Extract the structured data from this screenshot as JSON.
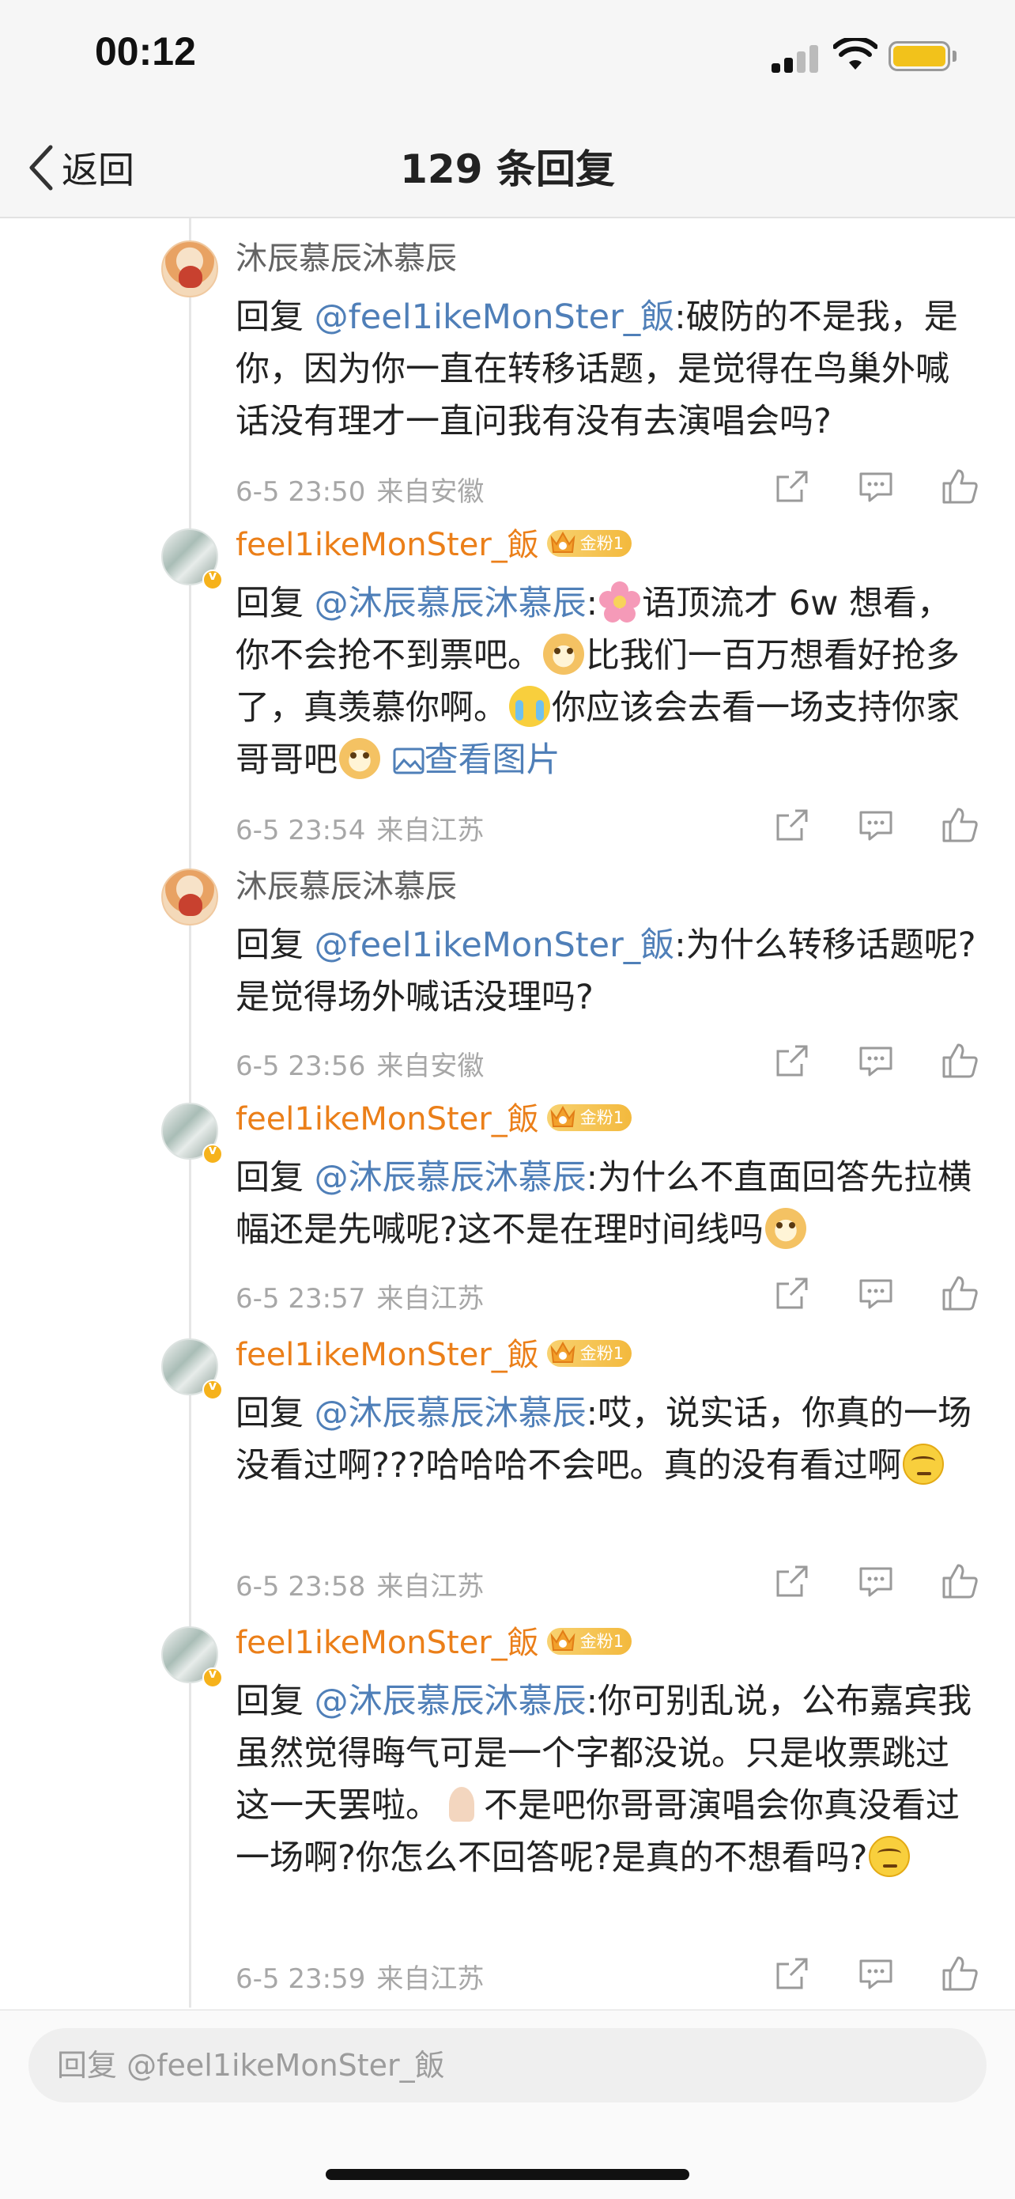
{
  "status_bar": {
    "time": "00:12"
  },
  "nav": {
    "back_label": "返回",
    "title": "129 条回复"
  },
  "replies": [
    {
      "user": "沐辰慕辰沐慕辰",
      "badge": "",
      "prefix": "回复 ",
      "mention": "@feel1ikeMonSter_飯",
      "text_parts": [
        ":破防的不是我，是你，因为你一直在转移话题，是觉得在鸟巢外喊话没有理才一直问我有没有去演唱会吗?"
      ],
      "time": "6-5 23:50",
      "source": "来自安徽"
    },
    {
      "user": "feel1ikeMonSter_飯",
      "badge": "金粉1",
      "prefix": "回复 ",
      "mention": "@沐辰慕辰沐慕辰",
      "text_parts": [
        ":",
        "语顶流才 6w 想看，你不会抢不到票吧。",
        "比我们一百万想看好抢多了，真羡慕你啊。",
        "你应该会去看一场支持你家哥哥吧"
      ],
      "link": "查看图片",
      "time": "6-5 23:54",
      "source": "来自江苏"
    },
    {
      "user": "沐辰慕辰沐慕辰",
      "badge": "",
      "prefix": "回复 ",
      "mention": "@feel1ikeMonSter_飯",
      "text_parts": [
        ":为什么转移话题呢?是觉得场外喊话没理吗?"
      ],
      "time": "6-5 23:56",
      "source": "来自安徽"
    },
    {
      "user": "feel1ikeMonSter_飯",
      "badge": "金粉1",
      "prefix": "回复 ",
      "mention": "@沐辰慕辰沐慕辰",
      "text_parts": [
        ":为什么不直面回答先拉横幅还是先喊呢?这不是在理时间线吗"
      ],
      "time": "6-5 23:57",
      "source": "来自江苏"
    },
    {
      "user": "feel1ikeMonSter_飯",
      "badge": "金粉1",
      "prefix": "回复 ",
      "mention": "@沐辰慕辰沐慕辰",
      "text_parts": [
        ":哎，说实话，你真的一场没看过啊???哈哈哈不会吧。真的没有看过啊"
      ],
      "time": "6-5 23:58",
      "source": "来自江苏"
    },
    {
      "user": "feel1ikeMonSter_飯",
      "badge": "金粉1",
      "prefix": "回复 ",
      "mention": "@沐辰慕辰沐慕辰",
      "text_parts": [
        ":你可别乱说，公布嘉宾我虽然觉得晦气可是一个字都没说。只是收票跳过这一天罢啦。",
        "不是吧你哥哥演唱会你真没看过一场啊?你怎么不回答呢?是真的不想看吗?"
      ],
      "time": "6-5 23:59",
      "source": "来自江苏"
    }
  ],
  "input": {
    "placeholder": "回复 @feel1ikeMonSter_飯"
  },
  "icons": {
    "back": "chevron-left-icon",
    "repost": "repost-icon",
    "comment": "comment-icon",
    "like": "thumbs-up-icon",
    "image": "image-icon"
  },
  "colors": {
    "username_orange": "#eb7f19",
    "mention_blue": "#4f7fb8",
    "badge_gold": "#f3b93d"
  }
}
